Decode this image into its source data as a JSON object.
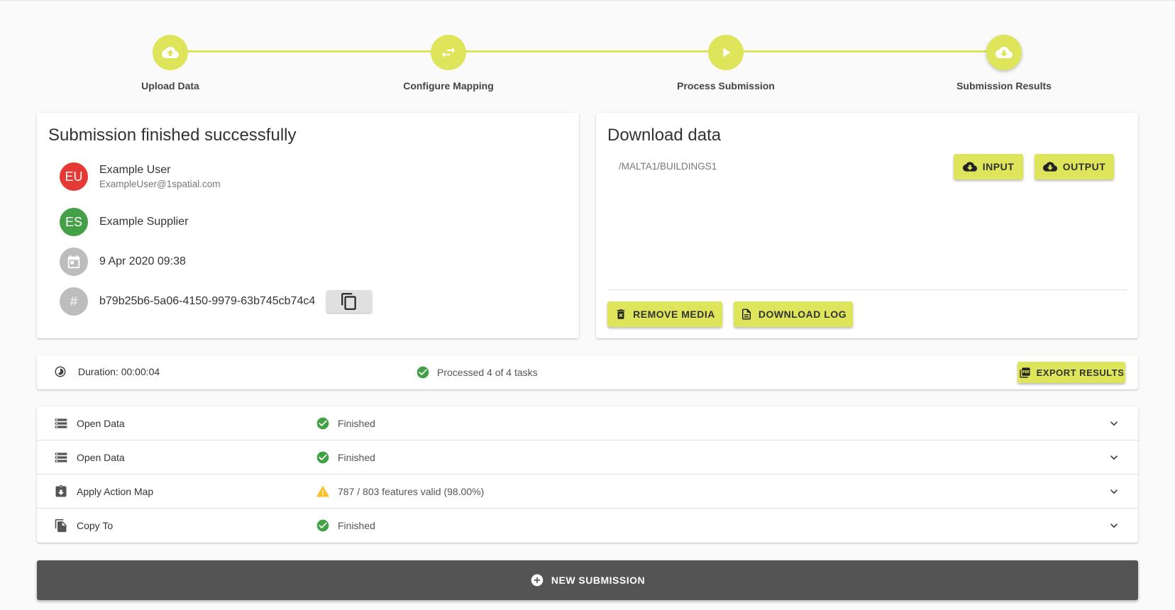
{
  "stepper": {
    "steps": [
      {
        "label": "Upload Data",
        "icon": "cloud-upload-icon"
      },
      {
        "label": "Configure Mapping",
        "icon": "swap-icon"
      },
      {
        "label": "Process Submission",
        "icon": "play-icon"
      },
      {
        "label": "Submission Results",
        "icon": "cloud-download-icon"
      }
    ],
    "accent": "#dfe55a"
  },
  "submission": {
    "title": "Submission finished successfully",
    "user": {
      "initials": "EU",
      "name": "Example User",
      "email": "ExampleUser@1spatial.com",
      "color": "#e53935"
    },
    "supplier": {
      "initials": "ES",
      "name": "Example Supplier",
      "color": "#43a047"
    },
    "date": "9 Apr 2020 09:38",
    "hash_symbol": "#",
    "id": "b79b25b6-5a06-4150-9979-63b745cb74c4"
  },
  "download": {
    "title": "Download data",
    "path": "/MALTA1/BUILDINGS1",
    "input_label": "INPUT",
    "output_label": "OUTPUT",
    "remove_media_label": "REMOVE MEDIA",
    "download_log_label": "DOWNLOAD LOG"
  },
  "summary": {
    "duration": "Duration: 00:00:04",
    "processed": "Processed 4 of 4 tasks",
    "export_label": "EXPORT RESULTS"
  },
  "tasks": [
    {
      "name": "Open Data",
      "status": "Finished",
      "status_type": "success"
    },
    {
      "name": "Open Data",
      "status": "Finished",
      "status_type": "success"
    },
    {
      "name": "Apply Action Map",
      "status": "787 / 803 features valid (98.00%)",
      "status_type": "warning"
    },
    {
      "name": "Copy To",
      "status": "Finished",
      "status_type": "success"
    }
  ],
  "new_submission_label": "NEW SUBMISSION"
}
